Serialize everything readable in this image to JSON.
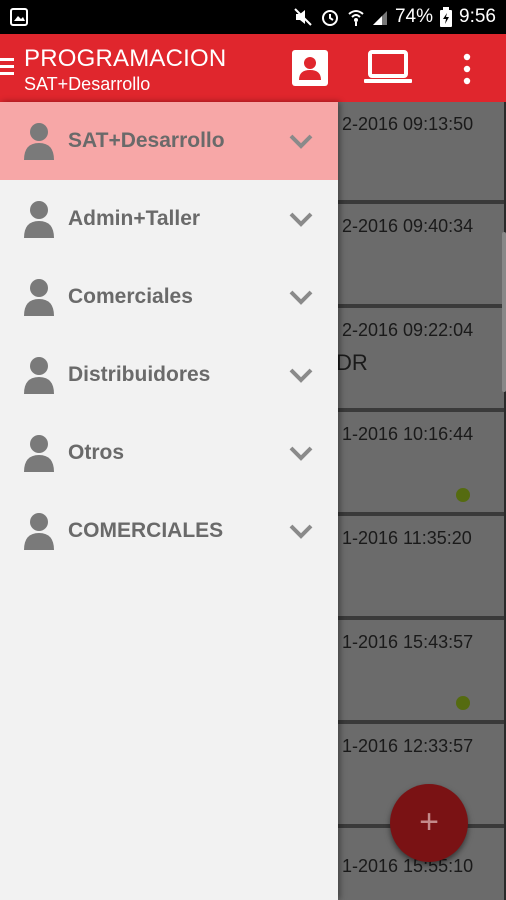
{
  "status_bar": {
    "battery_percent": "74%",
    "time": "9:56"
  },
  "app_bar": {
    "title": "PROGRAMACION",
    "subtitle": "SAT+Desarrollo"
  },
  "drawer": {
    "items": [
      {
        "label": "SAT+Desarrollo",
        "active": true
      },
      {
        "label": "Admin+Taller"
      },
      {
        "label": "Comerciales"
      },
      {
        "label": "Distribuidores"
      },
      {
        "label": "Otros"
      },
      {
        "label": "COMERCIALES"
      }
    ]
  },
  "cards": [
    {
      "date": "2-2016 09:13:50"
    },
    {
      "date": "2-2016 09:40:34"
    },
    {
      "date": "2-2016 09:22:04",
      "extra": "DR"
    },
    {
      "date": "1-2016 10:16:44"
    },
    {
      "date": "1-2016 11:35:20"
    },
    {
      "date": "1-2016 15:43:57"
    },
    {
      "date": "1-2016 12:33:57"
    },
    {
      "date": "1-2016 15:55:10"
    }
  ],
  "fab": {
    "label": "+"
  },
  "colors": {
    "app_bar": "#e0262d",
    "drawer_active": "#f7a7a7",
    "status_dot": "#556b10"
  }
}
